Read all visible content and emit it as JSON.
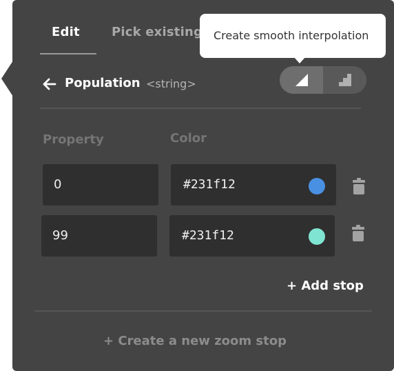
{
  "tabs": [
    {
      "label": "Edit",
      "active": true
    },
    {
      "label": "Pick existing",
      "active": false
    }
  ],
  "tooltip": {
    "text": "Create smooth interpolation"
  },
  "header": {
    "property_name": "Population",
    "property_type": "<string>",
    "back_icon": "arrow-left-icon",
    "interpolation": {
      "options": [
        {
          "icon": "smooth-interpolation-icon",
          "selected": true
        },
        {
          "icon": "step-interpolation-icon",
          "selected": false
        }
      ]
    }
  },
  "columns": {
    "property": "Property",
    "color": "Color"
  },
  "stops": [
    {
      "property": "0",
      "color_text": "#231f12",
      "swatch_color": "#4a90e2"
    },
    {
      "property": "99",
      "color_text": "#231f12",
      "swatch_color": "#7fe5d2"
    }
  ],
  "actions": {
    "add_stop": "+ Add stop",
    "create_zoom_stop": "+ Create a new zoom stop"
  },
  "colors": {
    "panel_bg": "#444444",
    "field_bg": "#2f2f2f",
    "text_primary": "#ffffff",
    "text_muted": "#757575"
  }
}
